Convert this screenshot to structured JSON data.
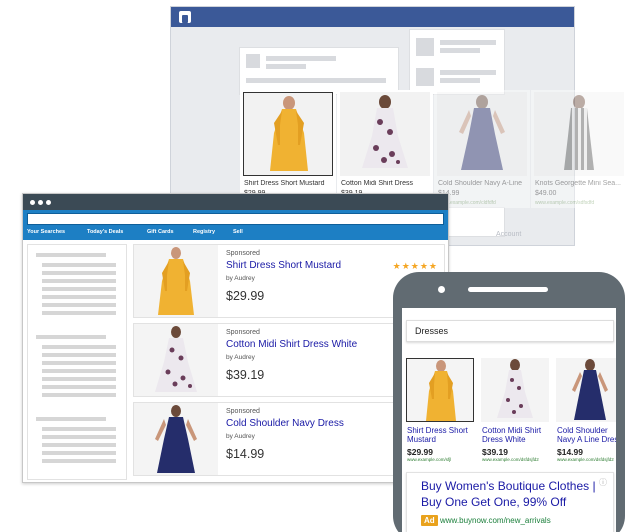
{
  "colors": {
    "social_bar": "#3b5998",
    "store_nav": "#1d7fc4",
    "link_blue": "#1a1aa6",
    "star": "#f5a623",
    "ad_badge": "#e9a21d",
    "dress_yellow": "#f0b232",
    "dress_navy": "#252d6b"
  },
  "back_window": {
    "faded_text": "Account",
    "carousel": [
      {
        "title": "Shirt Dress Short Mustard",
        "price": "$29.99",
        "url": "",
        "icon": "yellow-dress"
      },
      {
        "title": "Cotton Midi Shirt Dress",
        "price": "$39.19",
        "url": "",
        "icon": "floral-dress"
      },
      {
        "title": "Cold Shoulder Navy A-Line",
        "price": "$14.99",
        "url": "www.example.com/cldfdfd",
        "icon": "navy-dress"
      },
      {
        "title": "Knots Georgette Mini Sea...",
        "price": "$49.00",
        "url": "www.example.com/sdfsdfd",
        "icon": "striped-dress"
      }
    ]
  },
  "desktop": {
    "nav": [
      "Your Searches",
      "Today's Deals",
      "Gift Cards",
      "Registry",
      "Sell"
    ],
    "results": [
      {
        "sponsored": "Sponsored",
        "title": "Shirt Dress Short Mustard",
        "by": "by Audrey",
        "price": "$29.99",
        "stars": "★★★★★"
      },
      {
        "sponsored": "Sponsored",
        "title": "Cotton Midi Shirt Dress White",
        "by": "by Audrey",
        "price": "$39.19"
      },
      {
        "sponsored": "Sponsored",
        "title": "Cold Shoulder Navy Dress",
        "by": "by Audrey",
        "price": "$14.99"
      }
    ]
  },
  "mobile": {
    "search_text": "Dresses",
    "items": [
      {
        "title": "Shirt Dress Short Mustard",
        "price": "$29.99",
        "url": "www.example.com/sfjl"
      },
      {
        "title": "Cotton Midi Shirt Dress White",
        "price": "$39.19",
        "url": "www.example.com/dsfdsjfd2"
      },
      {
        "title": "Cold Shoulder Navy A Line Dress",
        "price": "$14.99",
        "url": "www.example.com/dsfdsjfd2"
      }
    ],
    "ad": {
      "headline1": "Buy Women's Boutique Clothes |",
      "headline2": "Buy One Get One, 99% Off",
      "badge": "Ad",
      "url": "www.buynow.com/new_arrivals",
      "info_icon": "ⓘ"
    }
  }
}
